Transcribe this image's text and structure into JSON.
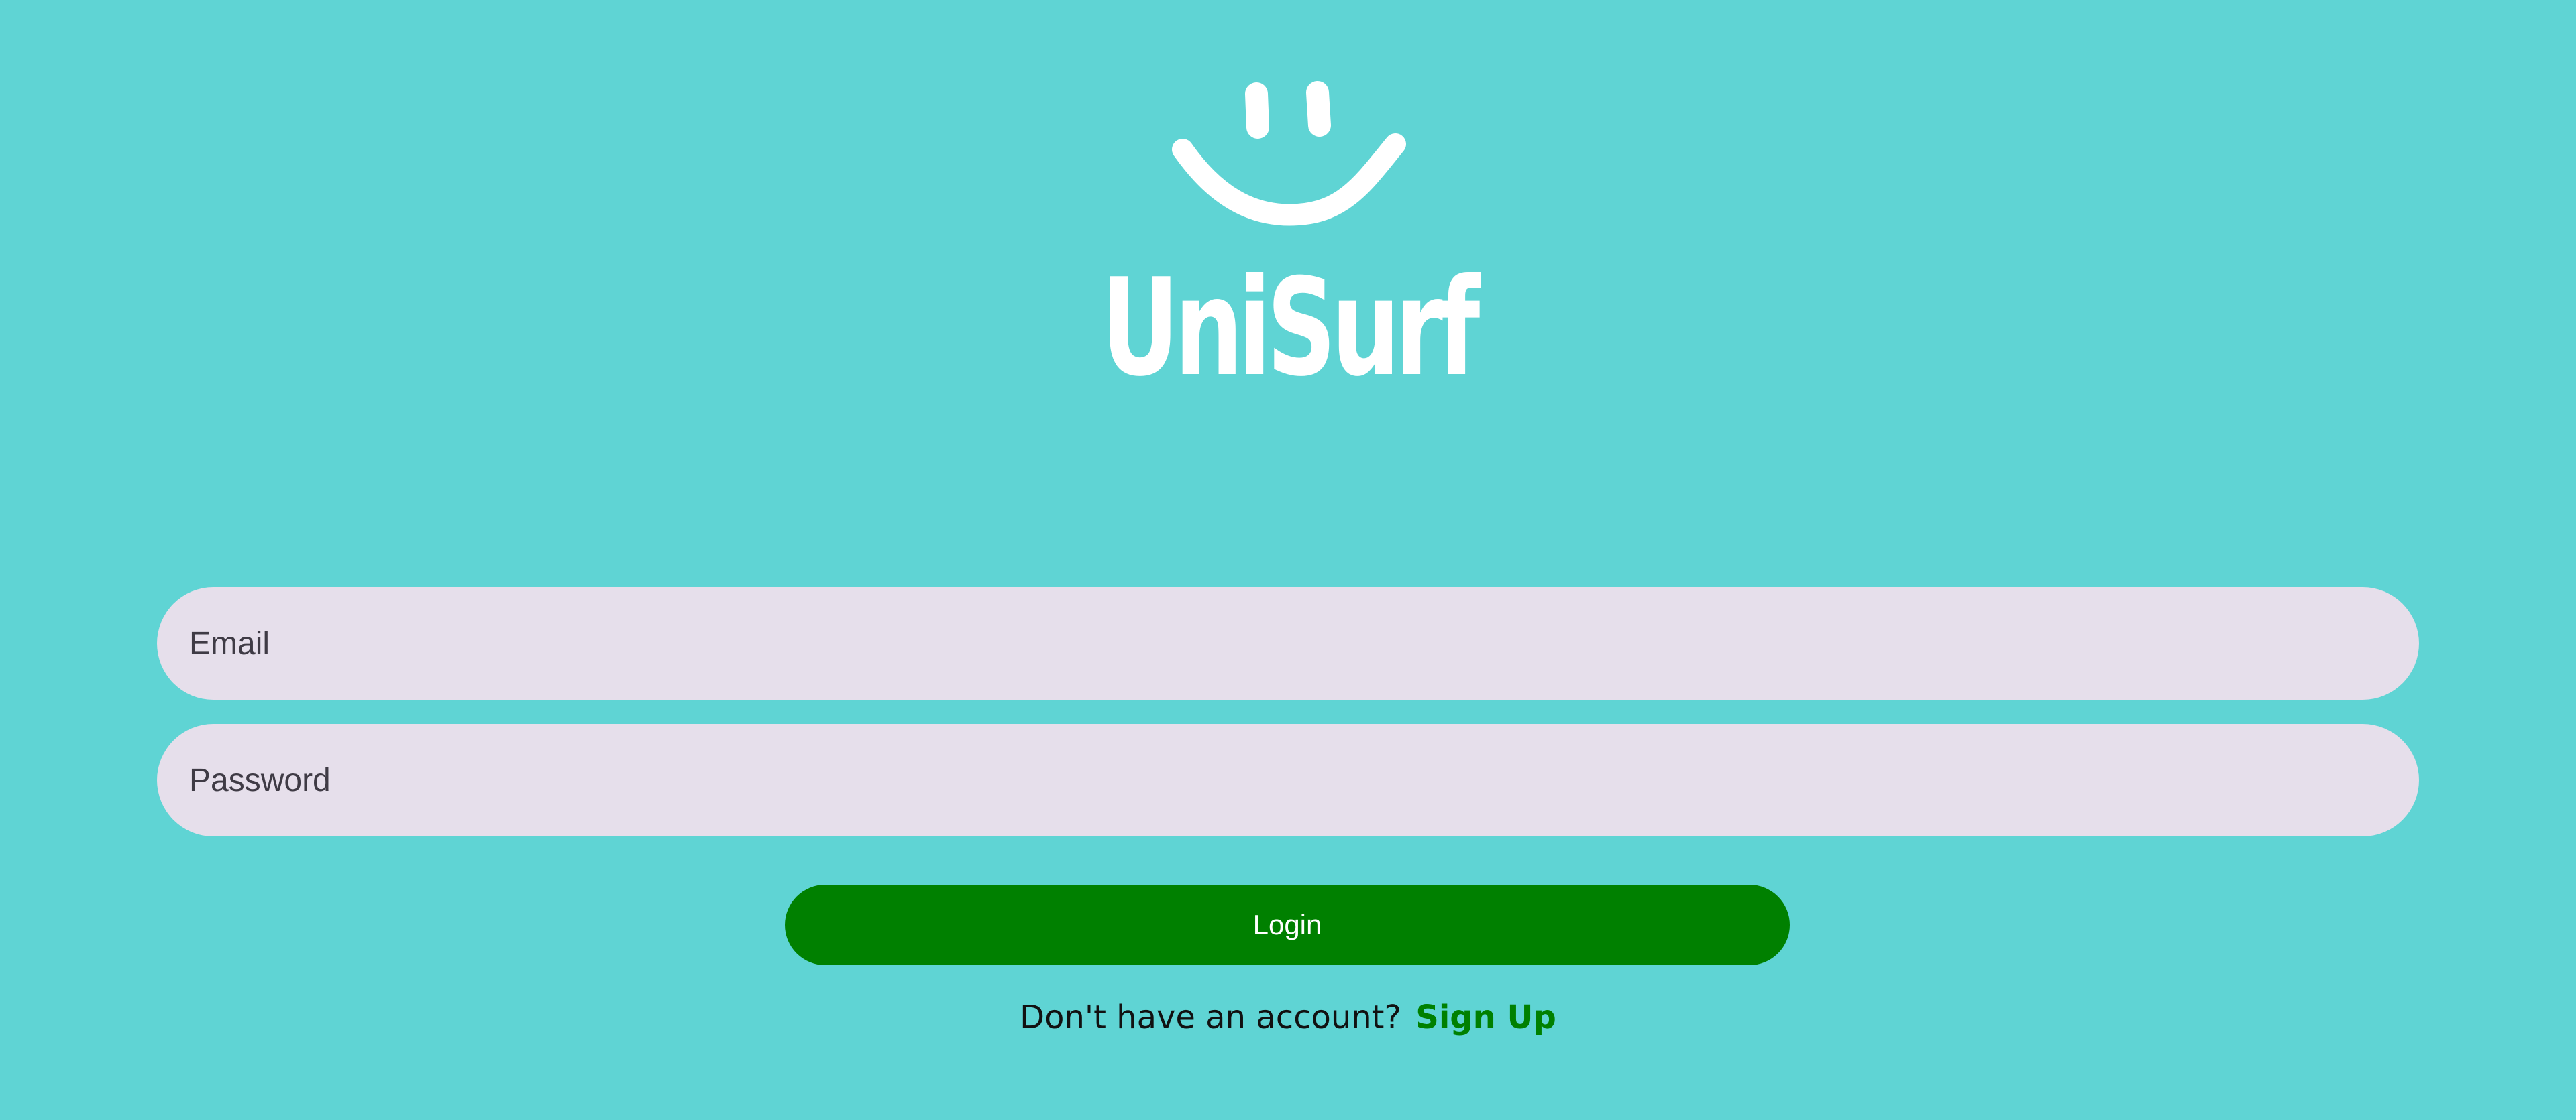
{
  "brand": {
    "logo_icon": "smiley-face-icon",
    "name": "UniSurf"
  },
  "login_form": {
    "email": {
      "placeholder": "Email",
      "value": ""
    },
    "password": {
      "placeholder": "Password",
      "value": ""
    },
    "login_label": "Login"
  },
  "signup": {
    "prompt": "Don't have an account?",
    "link_label": "Sign Up"
  },
  "colors": {
    "background": "#5fd4d4",
    "input_background": "#e6dfeb",
    "primary": "#008000",
    "logo": "#ffffff"
  }
}
